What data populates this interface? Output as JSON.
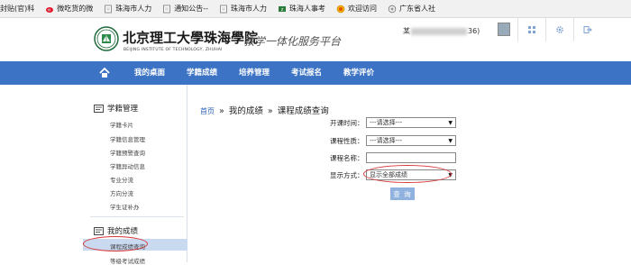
{
  "bookmarks": [
    {
      "label": "封贴(官)科",
      "icon": "bookmark-icon"
    },
    {
      "label": "微吃货的微",
      "icon": "weibo-icon"
    },
    {
      "label": "珠海市人力",
      "icon": "page-icon"
    },
    {
      "label": "通知公告--",
      "icon": "page-icon"
    },
    {
      "label": "珠海市人力",
      "icon": "page-icon"
    },
    {
      "label": "珠海人事考",
      "icon": "page-icon"
    },
    {
      "label": "欢迎访问",
      "icon": "globe-icon"
    },
    {
      "label": "广东省人社",
      "icon": "emblem-icon"
    }
  ],
  "header": {
    "school_cn": "北京理工大學珠海學院",
    "school_en": "BEIJING INSTITUTE OF TECHNOLOGY, ZHUHAI",
    "platform": "教学一体化服务平台",
    "user_prefix": "某",
    "user_suffix": "36)"
  },
  "nav": {
    "items": [
      "我的桌面",
      "学籍成绩",
      "培养管理",
      "考试报名",
      "教学评价"
    ]
  },
  "sidebar": {
    "section1_title": "学籍管理",
    "section1_links": [
      "学籍卡片",
      "学籍信息管理",
      "学籍预警查询",
      "学籍异动信息",
      "专业分流",
      "方向分流",
      "学生证补办"
    ],
    "section2_title": "我的成绩",
    "section2_links": [
      "课程成绩查询",
      "等级考试成绩"
    ]
  },
  "main": {
    "breadcrumb_home": "首页",
    "breadcrumb_sep": "»",
    "breadcrumb_mid": "我的成绩",
    "breadcrumb_current": "课程成绩查询",
    "form": {
      "term_label": "开课时间：",
      "term_value": "---请选择---",
      "nature_label": "课程性质：",
      "nature_value": "---请选择---",
      "name_label": "课程名称：",
      "name_value": "",
      "display_label": "显示方式：",
      "display_value": "显示全部成绩"
    },
    "query_button": "查 询"
  },
  "colors": {
    "nav_bg": "#3c73c4",
    "active_item_bg": "#c8d9f0",
    "annotation_red": "#d8383a",
    "button_bg": "#8fb2de"
  }
}
